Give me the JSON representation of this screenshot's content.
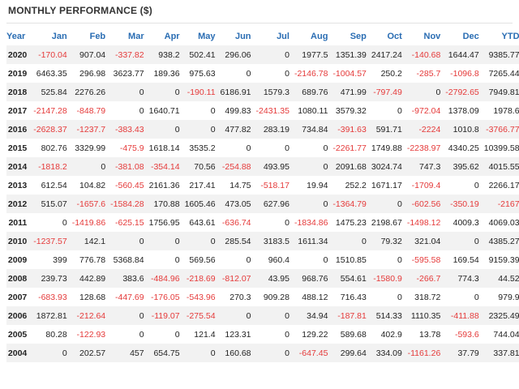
{
  "title": "MONTHLY PERFORMANCE ($)",
  "colors": {
    "header": "#2a6db3",
    "negative": "#e53a3a",
    "row_shade": "#f2f2f2"
  },
  "columns": [
    "Year",
    "Jan",
    "Feb",
    "Mar",
    "Apr",
    "May",
    "Jun",
    "Jul",
    "Aug",
    "Sep",
    "Oct",
    "Nov",
    "Dec",
    "YTD"
  ],
  "rows": [
    [
      "2020",
      "-170.04",
      "907.04",
      "-337.82",
      "938.2",
      "502.41",
      "296.06",
      "0",
      "1977.5",
      "1351.39",
      "2417.24",
      "-140.68",
      "1644.47",
      "9385.77"
    ],
    [
      "2019",
      "6463.35",
      "296.98",
      "3623.77",
      "189.36",
      "975.63",
      "0",
      "0",
      "-2146.78",
      "-1004.57",
      "250.2",
      "-285.7",
      "-1096.8",
      "7265.44"
    ],
    [
      "2018",
      "525.84",
      "2276.26",
      "0",
      "0",
      "-190.11",
      "6186.91",
      "1579.3",
      "689.76",
      "471.99",
      "-797.49",
      "0",
      "-2792.65",
      "7949.81"
    ],
    [
      "2017",
      "-2147.28",
      "-848.79",
      "0",
      "1640.71",
      "0",
      "499.83",
      "-2431.35",
      "1080.11",
      "3579.32",
      "0",
      "-972.04",
      "1378.09",
      "1978.6"
    ],
    [
      "2016",
      "-2628.37",
      "-1237.7",
      "-383.43",
      "0",
      "0",
      "477.82",
      "283.19",
      "734.84",
      "-391.63",
      "591.71",
      "-2224",
      "1010.8",
      "-3766.77"
    ],
    [
      "2015",
      "802.76",
      "3329.99",
      "-475.9",
      "1618.14",
      "3535.2",
      "0",
      "0",
      "0",
      "-2261.77",
      "1749.88",
      "-2238.97",
      "4340.25",
      "10399.58"
    ],
    [
      "2014",
      "-1818.2",
      "0",
      "-381.08",
      "-354.14",
      "70.56",
      "-254.88",
      "493.95",
      "0",
      "2091.68",
      "3024.74",
      "747.3",
      "395.62",
      "4015.55"
    ],
    [
      "2013",
      "612.54",
      "104.82",
      "-560.45",
      "2161.36",
      "217.41",
      "14.75",
      "-518.17",
      "19.94",
      "252.2",
      "1671.17",
      "-1709.4",
      "0",
      "2266.17"
    ],
    [
      "2012",
      "515.07",
      "-1657.6",
      "-1584.28",
      "170.88",
      "1605.46",
      "473.05",
      "627.96",
      "0",
      "-1364.79",
      "0",
      "-602.56",
      "-350.19",
      "-2167"
    ],
    [
      "2011",
      "0",
      "-1419.86",
      "-625.15",
      "1756.95",
      "643.61",
      "-636.74",
      "0",
      "-1834.86",
      "1475.23",
      "2198.67",
      "-1498.12",
      "4009.3",
      "4069.03"
    ],
    [
      "2010",
      "-1237.57",
      "142.1",
      "0",
      "0",
      "0",
      "285.54",
      "3183.5",
      "1611.34",
      "0",
      "79.32",
      "321.04",
      "0",
      "4385.27"
    ],
    [
      "2009",
      "399",
      "776.78",
      "5368.84",
      "0",
      "569.56",
      "0",
      "960.4",
      "0",
      "1510.85",
      "0",
      "-595.58",
      "169.54",
      "9159.39"
    ],
    [
      "2008",
      "239.73",
      "442.89",
      "383.6",
      "-484.96",
      "-218.69",
      "-812.07",
      "43.95",
      "968.76",
      "554.61",
      "-1580.9",
      "-266.7",
      "774.3",
      "44.52"
    ],
    [
      "2007",
      "-683.93",
      "128.68",
      "-447.69",
      "-176.05",
      "-543.96",
      "270.3",
      "909.28",
      "488.12",
      "716.43",
      "0",
      "318.72",
      "0",
      "979.9"
    ],
    [
      "2006",
      "1872.81",
      "-212.64",
      "0",
      "-119.07",
      "-275.54",
      "0",
      "0",
      "34.94",
      "-187.81",
      "514.33",
      "1110.35",
      "-411.88",
      "2325.49"
    ],
    [
      "2005",
      "80.28",
      "-122.93",
      "0",
      "0",
      "121.4",
      "123.31",
      "0",
      "129.22",
      "589.68",
      "402.9",
      "13.78",
      "-593.6",
      "744.04"
    ],
    [
      "2004",
      "0",
      "202.57",
      "457",
      "654.75",
      "0",
      "160.68",
      "0",
      "-647.45",
      "299.64",
      "334.09",
      "-1161.26",
      "37.79",
      "337.81"
    ]
  ]
}
